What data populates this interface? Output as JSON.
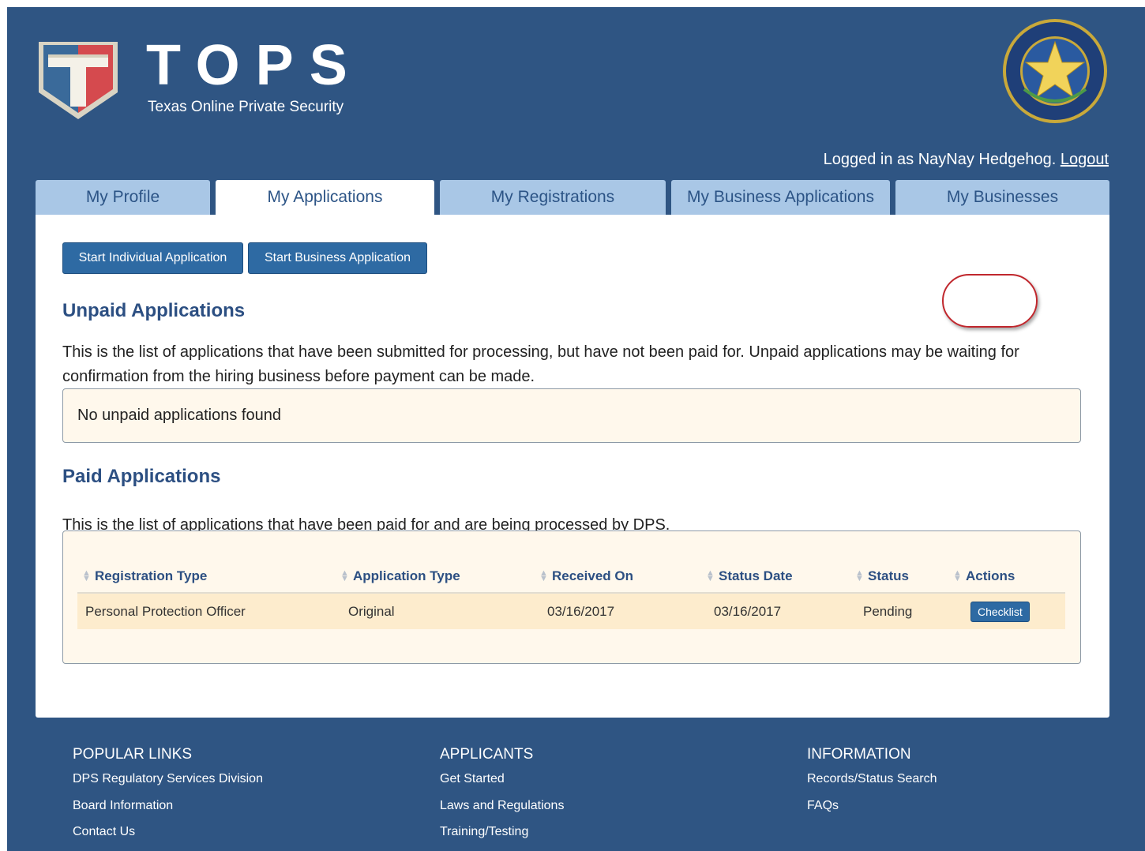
{
  "header": {
    "logo_title": "TOPS",
    "logo_subtitle": "Texas Online Private Security",
    "seal_icon": "texas-dps-seal",
    "login_text": "Logged in as NayNay Hedgehog.",
    "logout_label": "Logout"
  },
  "tabs": [
    {
      "label": "My Profile",
      "active": false
    },
    {
      "label": "My Applications",
      "active": true
    },
    {
      "label": "My Registrations",
      "active": false
    },
    {
      "label": "My Business Applications",
      "active": false
    },
    {
      "label": "My Businesses",
      "active": false
    }
  ],
  "main": {
    "buttons": {
      "start_individual": "Start Individual Application",
      "start_business": "Start Business Application"
    },
    "unpaid": {
      "heading": "Unpaid Applications",
      "description": "This is the list of applications that have been submitted for processing, but have not been paid for. Unpaid applications may be waiting for confirmation from the hiring business before payment can be made.",
      "empty_message": "No unpaid applications found"
    },
    "paid": {
      "heading": "Paid Applications",
      "description": "This is the list of applications that have been paid for and are being processed by DPS.",
      "columns": [
        "Registration Type",
        "Application Type",
        "Received On",
        "Status Date",
        "Status",
        "Actions"
      ],
      "rows": [
        {
          "registration_type": "Personal Protection Officer",
          "application_type": "Original",
          "received_on": "03/16/2017",
          "status_date": "03/16/2017",
          "status": "Pending",
          "action_label": "Checklist"
        }
      ]
    }
  },
  "footer": {
    "popular": {
      "heading": "POPULAR LINKS",
      "links": [
        "DPS Regulatory Services Division",
        "Board Information",
        "Contact Us"
      ]
    },
    "applicants": {
      "heading": "APPLICANTS",
      "links": [
        "Get Started",
        "Laws and Regulations",
        "Training/Testing"
      ]
    },
    "information": {
      "heading": "INFORMATION",
      "links": [
        "Records/Status Search",
        "FAQs"
      ]
    }
  },
  "colors": {
    "page_bg": "#2f5583",
    "tab_inactive": "#a9c7e6",
    "button": "#2e6aa3",
    "heading": "#2c4f82",
    "panel_box": "#fff8ec",
    "highlight": "#c0272d"
  }
}
